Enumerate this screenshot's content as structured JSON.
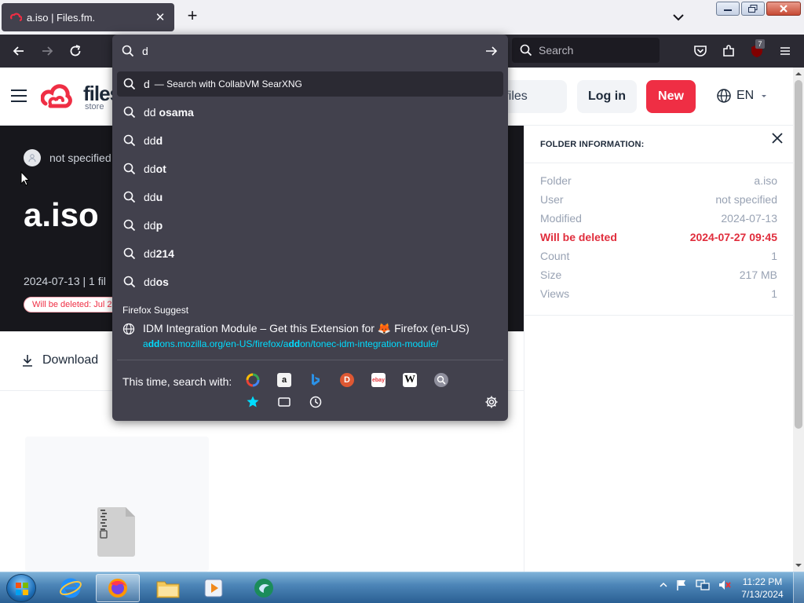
{
  "browser": {
    "tab": {
      "title": "a.iso | Files.fm.",
      "close": "✕"
    },
    "new_tab": "+",
    "search_placeholder": "Search",
    "extension_badge": "7"
  },
  "urlbar": {
    "typed": "d",
    "suggestions": [
      {
        "prefix": "d",
        "bold": "",
        "action": "— Search with CollabVM SearXNG",
        "selected": true
      },
      {
        "prefix": "dd ",
        "bold": "osama"
      },
      {
        "prefix": "dd",
        "bold": "d"
      },
      {
        "prefix": "dd",
        "bold": "ot"
      },
      {
        "prefix": "dd",
        "bold": "u"
      },
      {
        "prefix": "dd",
        "bold": "p"
      },
      {
        "prefix": "dd",
        "bold": "214"
      },
      {
        "prefix": "dd",
        "bold": "os"
      }
    ],
    "firefox_suggest_label": "Firefox Suggest",
    "extension_suggestion": {
      "title": "IDM Integration Module – Get this Extension for 🦊 Firefox (en-US)",
      "url_parts": [
        {
          "text": "a",
          "hl": false
        },
        {
          "text": "dd",
          "hl": true
        },
        {
          "text": "ons.mozilla.org/en-US/firefox/a",
          "hl": false
        },
        {
          "text": "dd",
          "hl": true
        },
        {
          "text": "on/tonec-idm-integration-module/",
          "hl": false
        }
      ]
    },
    "engines_label": "This time, search with:",
    "engines": [
      "google",
      "amazon",
      "bing",
      "duckduckgo",
      "ebay",
      "wikipedia",
      "searxng",
      "bookmarks",
      "tabs",
      "history"
    ]
  },
  "site": {
    "logo_text": "files",
    "logo_sub": "store",
    "upload_label": "d files",
    "login_label": "Log in",
    "new_label": "New",
    "language": "EN"
  },
  "hero": {
    "owner": "not specified",
    "title": "a.iso",
    "meta": "2024-07-13 | 1 fil",
    "delete_pill": "Will be deleted: Jul 2"
  },
  "actions": {
    "download_label": "Download"
  },
  "folder_info": {
    "heading": "FOLDER INFORMATION:",
    "rows": [
      {
        "label": "Folder",
        "value": "a.iso",
        "warn": false
      },
      {
        "label": "User",
        "value": "not specified",
        "warn": false
      },
      {
        "label": "Modified",
        "value": "2024-07-13",
        "warn": false
      },
      {
        "label": "Will be deleted",
        "value": "2024-07-27 09:45",
        "warn": true
      },
      {
        "label": "Count",
        "value": "1",
        "warn": false
      },
      {
        "label": "Size",
        "value": "217 MB",
        "warn": false
      },
      {
        "label": "Views",
        "value": "1",
        "warn": false
      }
    ]
  },
  "taskbar": {
    "clock_time": "11:22 PM",
    "clock_date": "7/13/2024"
  },
  "colors": {
    "brand_red": "#ef2e44",
    "urlbar_bg": "#42414d",
    "url_highlight": "#00ddff"
  }
}
